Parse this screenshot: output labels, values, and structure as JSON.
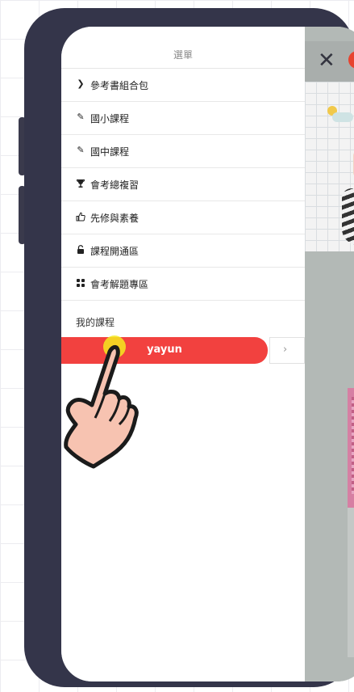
{
  "menu": {
    "title": "選單",
    "items": [
      {
        "label": "參考書組合包",
        "icon": "chevron-right-icon",
        "glyph": "❯"
      },
      {
        "label": "國小課程",
        "icon": "pencil-icon",
        "glyph": "✎"
      },
      {
        "label": "國中課程",
        "icon": "pencil-icon",
        "glyph": "✎"
      },
      {
        "label": "會考總複習",
        "icon": "trophy-icon",
        "glyph": "🏆"
      },
      {
        "label": "先修與素養",
        "icon": "thumbs-up-icon",
        "glyph": "👍"
      },
      {
        "label": "課程開通區",
        "icon": "unlock-icon",
        "glyph": "🔓"
      },
      {
        "label": "會考解題專區",
        "icon": "grid-icon",
        "glyph": "▦"
      }
    ],
    "my_courses_label": "我的課程",
    "user": {
      "name": "yayun",
      "chevron": "›"
    }
  },
  "background": {
    "close_glyph": "✕"
  },
  "colors": {
    "accent_red": "#f2413f",
    "phone_frame": "#34354a",
    "overlay": "#b4bab8"
  }
}
